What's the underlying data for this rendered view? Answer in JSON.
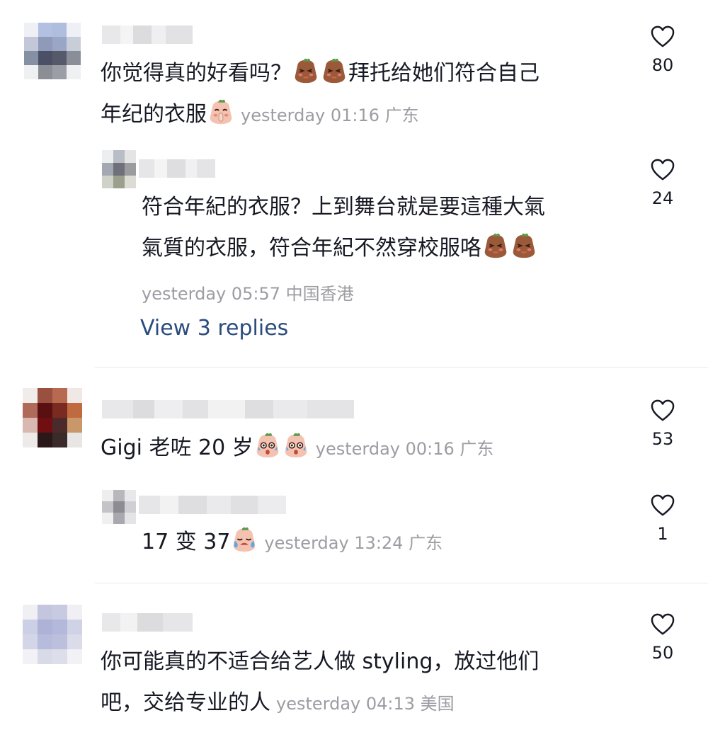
{
  "comments": [
    {
      "text_line1": "你觉得真的好看吗？",
      "text_line1_after": "拜托给她们符合自己",
      "text_line2": "年纪的衣服",
      "time": "yesterday 01:16 广东",
      "likes": "80"
    },
    {
      "text_line1": "符合年紀的衣服？上到舞台就是要這種大氣",
      "text_line2": "氣質的衣服，符合年紀不然穿校服咯",
      "time": "yesterday 05:57 中国香港",
      "likes": "24",
      "view_replies": "View 3 replies"
    },
    {
      "text_line1": "Gigi 老咗 20 岁",
      "time": "yesterday 00:16 广东",
      "likes": "53"
    },
    {
      "text_line1": "17 变 37",
      "time": "yesterday 13:24 广东",
      "likes": "1"
    },
    {
      "text_line1": "你可能真的不适合给艺人做 styling，放过他们",
      "text_line2": "吧，交给专业的人",
      "time": "yesterday 04:13 美国",
      "likes": "50"
    }
  ],
  "icons": {
    "like": "heart-outline-icon",
    "sticker_smirk": "smirk-sticker-icon",
    "sticker_shush": "shush-sticker-icon",
    "sticker_shock": "shocked-sticker-icon",
    "sticker_cry": "crying-sticker-icon"
  },
  "colors": {
    "text": "#161823",
    "meta": "#9c9ca3",
    "link": "#2b4c7e",
    "divider": "#e8e8ea"
  }
}
